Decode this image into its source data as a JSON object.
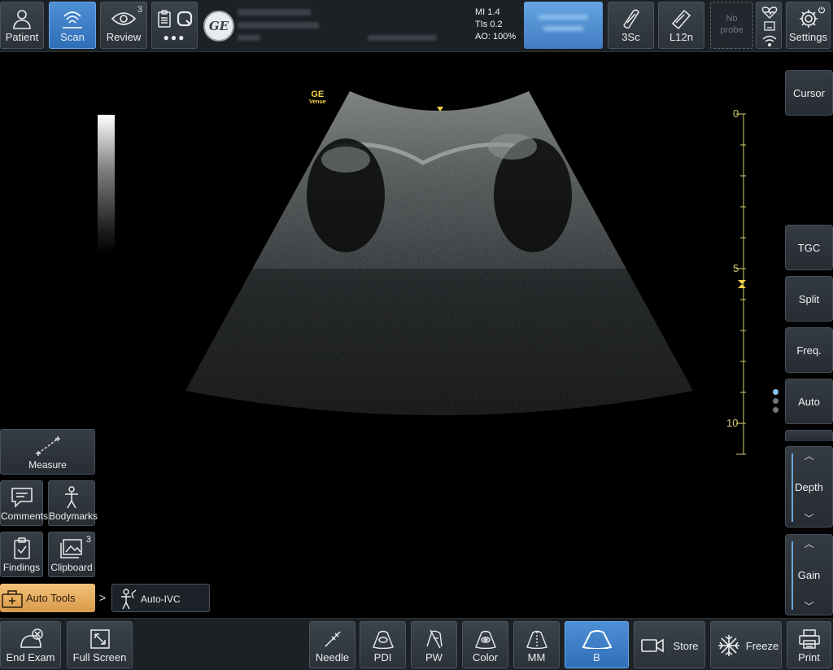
{
  "colors": {
    "accent": "#3f83cf",
    "toolbar": "#1c2126",
    "depth_scale": "#d4cf72",
    "auto_tools": "#e8ad5f"
  },
  "top": {
    "patient": {
      "label": "Patient",
      "icon": "person-icon"
    },
    "scan": {
      "label": "Scan",
      "icon": "probe-wave-icon"
    },
    "review": {
      "label": "Review",
      "count": "3",
      "icon": "eye-icon"
    },
    "more": {
      "label": "●●●",
      "icon": "clipboard-icon"
    },
    "params": {
      "mi": "MI 1.4",
      "tis": "TIs 0.2",
      "ao": "AO: 100%"
    },
    "probe1": {
      "label": "3Sc",
      "icon": "sector-probe-icon"
    },
    "probe2": {
      "label": "L12n",
      "icon": "linear-probe-icon"
    },
    "noprobe": {
      "label_line1": "No",
      "label_line2": "probe"
    },
    "settings": {
      "label": "Settings",
      "icon": "gear-icon"
    }
  },
  "scan": {
    "brand": "GE",
    "brand_sub": "Venue",
    "depth_scale": {
      "labels": [
        "0",
        "5",
        "10"
      ]
    }
  },
  "right": {
    "cursor": "Cursor",
    "tgc": "TGC",
    "split": "Split",
    "freq": "Freq.",
    "auto": "Auto",
    "depth": {
      "label": "Depth",
      "up": "︿",
      "down": "﹀"
    },
    "gain": {
      "label": "Gain",
      "up": "︿",
      "down": "﹀"
    }
  },
  "left": {
    "measure": "Measure",
    "comments": "Comments",
    "bodymarks": "Bodymarks",
    "findings": "Findings",
    "clipboard": {
      "label": "Clipboard",
      "count": "3"
    },
    "auto_tools": "Auto Tools",
    "chevron": ">",
    "auto_ivc": "Auto-IVC"
  },
  "bottom": {
    "end_exam": "End Exam",
    "full_screen": "Full Screen",
    "needle": "Needle",
    "pdi": "PDI",
    "pw": "PW",
    "color": "Color",
    "mm": "MM",
    "b": "B",
    "store": "Store",
    "freeze": "Freeze",
    "print": "Print"
  }
}
